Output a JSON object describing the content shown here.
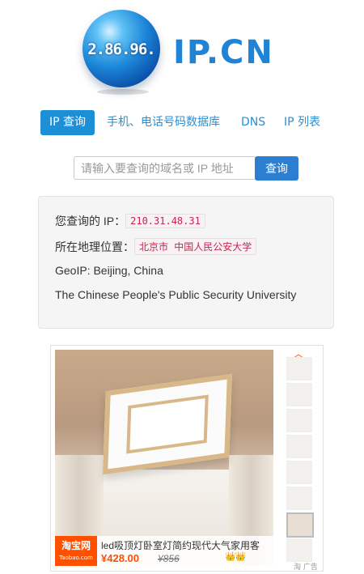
{
  "logo": {
    "globe_text": "2.86.96.",
    "brand": "IP.CN"
  },
  "nav": {
    "items": [
      {
        "label": "IP 查询",
        "active": true
      },
      {
        "label": "手机、电话号码数据库",
        "active": false
      },
      {
        "label": "DNS",
        "active": false
      },
      {
        "label": "IP 列表",
        "active": false
      }
    ]
  },
  "search": {
    "placeholder": "请输入要查询的域名或 IP 地址",
    "value": "",
    "button_label": "查询"
  },
  "result": {
    "ip_label": "您查询的 IP：",
    "ip_value": "210.31.48.31",
    "location_label": "所在地理位置：",
    "location_value": "北京市 中国人民公安大学",
    "geoip": "GeoIP: Beijing, China",
    "org": "The Chinese People's Public Security University"
  },
  "ad": {
    "logo_text": "淘宝网",
    "logo_sub": "Taobao.com",
    "title": "led吸顶灯卧室灯简约现代大气家用客",
    "price": "¥428.00",
    "old_price": "¥856",
    "badge": "👑👑",
    "footer": "淘 广告",
    "scroll_up": "︿"
  },
  "colors": {
    "accent": "#1d8fd6",
    "search_button": "#2c7fd0",
    "code_text": "#c7254e",
    "taobao": "#ff5000"
  }
}
